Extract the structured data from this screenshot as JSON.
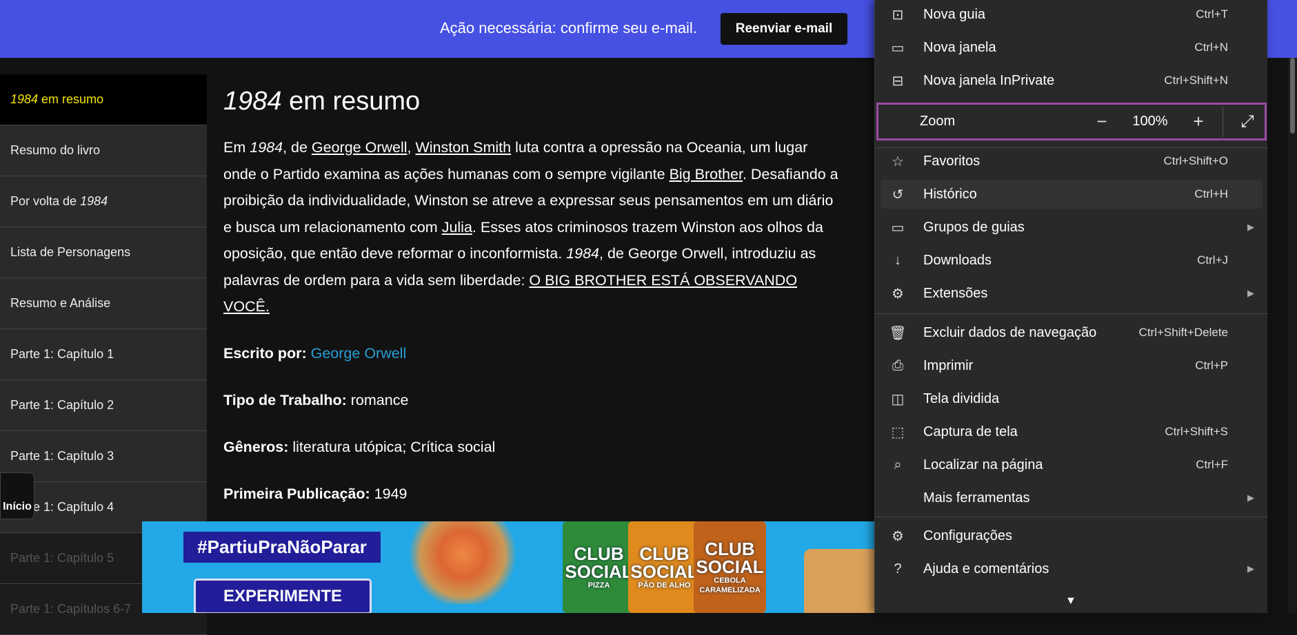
{
  "banner": {
    "message": "Ação necessária: confirme seu e-mail.",
    "button": "Reenviar e-mail"
  },
  "sidebar": {
    "items": [
      {
        "italic": "1984",
        "rest": " em resumo"
      },
      {
        "label": "Resumo do livro"
      },
      {
        "label": "Por volta de ",
        "italic": "1984"
      },
      {
        "label": "Lista de Personagens"
      },
      {
        "label": "Resumo e Análise"
      },
      {
        "label": "Parte 1: Capítulo 1"
      },
      {
        "label": "Parte 1: Capítulo 2"
      },
      {
        "label": "Parte 1: Capítulo 3"
      },
      {
        "label": "Parte 1: Capítulo 4"
      },
      {
        "label": "Parte 1: Capítulo 5"
      },
      {
        "label": "Parte 1: Capítulos 6-7"
      }
    ],
    "home_button": "Início"
  },
  "main": {
    "title_italic": "1984",
    "title_rest": " em resumo",
    "p": {
      "t1": "Em ",
      "i1": "1984",
      "t2": ", de ",
      "l1": "George Orwell",
      "t3": ", ",
      "l2": "Winston Smith",
      "t4": " luta contra a opressão na Oceania, um lugar onde o Partido examina as ações humanas com o sempre vigilante ",
      "l3": "Big Brother",
      "t5": ". Desafiando a proibição da individualidade, Winston se atreve a expressar seus pensamentos em um diário e busca um relacionamento com ",
      "l4": "Julia",
      "t6": ". Esses atos criminosos trazem Winston aos olhos da oposição, que então deve reformar o inconformista. ",
      "i2": "1984",
      "t7": ", de George Orwell, introduziu as palavras de ordem para a vida sem liberdade: ",
      "l5": "O BIG BROTHER ESTÁ OBSERVANDO VOCÊ."
    },
    "meta": [
      {
        "label": "Escrito por:",
        "value": " George Orwell"
      },
      {
        "label": "Tipo de Trabalho:",
        "value": " romance"
      },
      {
        "label": "Gêneros:",
        "value": " literatura utópica; Crítica social"
      },
      {
        "label": "Primeira Publicação:",
        "value": " 1949"
      }
    ]
  },
  "ad": {
    "hashtag": "#PartiuPraNãoParar",
    "cta": "EXPERIMENTE",
    "packs": [
      {
        "brand": "CLUB SOCIAL",
        "flavor": "PIZZA",
        "color": "#2e8b3a"
      },
      {
        "brand": "CLUB SOCIAL",
        "flavor": "PÃO DE ALHO",
        "color": "#e08a1e"
      },
      {
        "brand": "CLUB SOCIAL",
        "flavor": "CEBOLA CARAMELIZADA",
        "color": "#c0621a"
      }
    ]
  },
  "menu": {
    "items": [
      {
        "icon": "new-tab-icon",
        "label": "Nova guia",
        "shortcut": "Ctrl+T"
      },
      {
        "icon": "new-window-icon",
        "label": "Nova janela",
        "shortcut": "Ctrl+N"
      },
      {
        "icon": "inprivate-icon",
        "label": "Nova janela InPrivate",
        "shortcut": "Ctrl+Shift+N"
      },
      {
        "icon": "favorites-icon",
        "label": "Favoritos",
        "shortcut": "Ctrl+Shift+O"
      },
      {
        "icon": "history-icon",
        "label": "Histórico",
        "shortcut": "Ctrl+H"
      },
      {
        "icon": "tab-groups-icon",
        "label": "Grupos de guias",
        "shortcut": ""
      },
      {
        "icon": "download-icon",
        "label": "Downloads",
        "shortcut": "Ctrl+J"
      },
      {
        "icon": "extensions-icon",
        "label": "Extensões",
        "shortcut": ""
      },
      {
        "icon": "trash-icon",
        "label": "Excluir dados de navegação",
        "shortcut": "Ctrl+Shift+Delete"
      },
      {
        "icon": "print-icon",
        "label": "Imprimir",
        "shortcut": "Ctrl+P"
      },
      {
        "icon": "split-screen-icon",
        "label": "Tela dividida",
        "shortcut": ""
      },
      {
        "icon": "screenshot-icon",
        "label": "Captura de tela",
        "shortcut": "Ctrl+Shift+S"
      },
      {
        "icon": "find-icon",
        "label": "Localizar na página",
        "shortcut": "Ctrl+F"
      },
      {
        "icon": "",
        "label": "Mais ferramentas",
        "shortcut": ""
      },
      {
        "icon": "settings-icon",
        "label": "Configurações",
        "shortcut": ""
      },
      {
        "icon": "help-icon",
        "label": "Ajuda e comentários",
        "shortcut": ""
      }
    ],
    "zoom": {
      "label": "Zoom",
      "value": "100%"
    }
  }
}
